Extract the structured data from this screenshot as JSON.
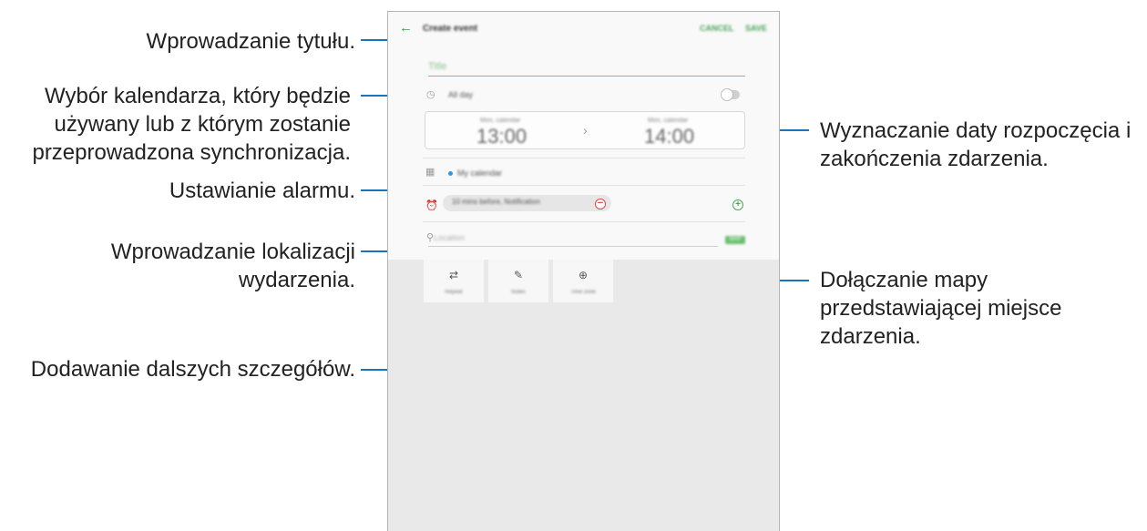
{
  "callouts": {
    "title": "Wprowadzanie tytułu.",
    "calendar_line1": "Wybór kalendarza, który będzie",
    "calendar_line2": "używany lub z którym zostanie",
    "calendar_line3": "przeprowadzona synchronizacja.",
    "alarm": "Ustawianie alarmu.",
    "location_line1": "Wprowadzanie lokalizacji",
    "location_line2": "wydarzenia.",
    "details": "Dodawanie dalszych szczegółów.",
    "dates_line1": "Wyznaczanie daty rozpoczęcia i",
    "dates_line2": "zakończenia zdarzenia.",
    "map_line1": "Dołączanie mapy",
    "map_line2": "przedstawiającej miejsce",
    "map_line3": "zdarzenia."
  },
  "app": {
    "back_icon": "arrow-left-icon",
    "title": "Create event",
    "cancel": "CANCEL",
    "save": "SAVE",
    "title_placeholder": "Title",
    "all_day": "All day",
    "start_date": "Mon, calendar",
    "start_time": "13:00",
    "end_date": "Mon, calendar",
    "end_time": "14:00",
    "calendar_name": "My calendar",
    "alarm_value": "10 mins before, Notification",
    "location_placeholder": "Location",
    "map_button": "MAP",
    "tiles": [
      {
        "label": "Repeat",
        "icon": "repeat-icon"
      },
      {
        "label": "Notes",
        "icon": "notes-icon"
      },
      {
        "label": "Time zone",
        "icon": "time-zone-icon"
      }
    ],
    "accent_color": "#4aa55a",
    "calendar_color": "#2d9ae0"
  }
}
